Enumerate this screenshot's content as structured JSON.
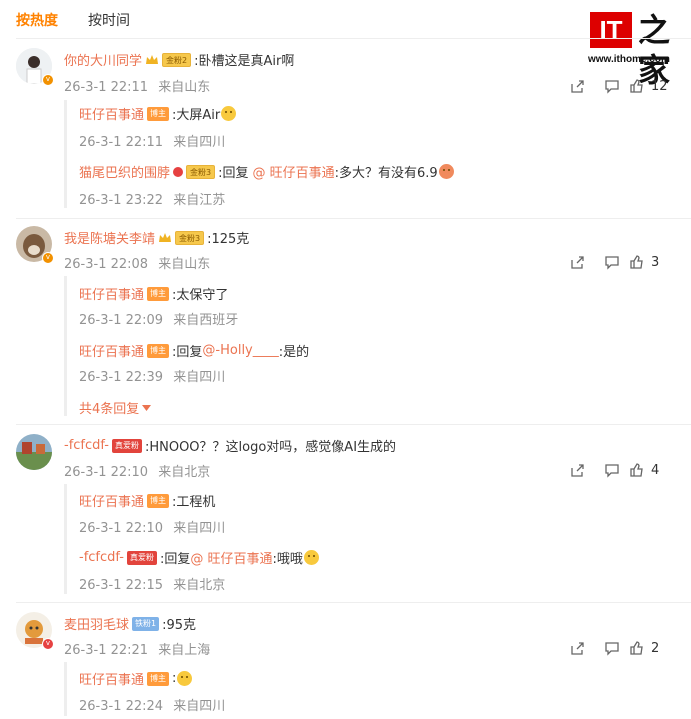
{
  "tabs": [
    {
      "label": "按热度"
    },
    {
      "label": "按时间"
    }
  ],
  "logo": {
    "mark": "IT",
    "chinese": "之家",
    "url": "www.ithome.com"
  },
  "comments": [
    {
      "user": "你的大川同学",
      "badge": "金粉2",
      "text": ":卧槽这是真Air啊",
      "time": "26-3-1 22:11",
      "location": "来自山东",
      "likes": "12",
      "replies": [
        {
          "user": "旺仔百事通",
          "badge": "博主",
          "text": ":大屏Air",
          "time": "26-3-1 22:11",
          "location": "来自四川"
        },
        {
          "user": "猫尾巴织的围脖",
          "badge": "金粉3",
          "prefix": ":回复",
          "at": "@ 旺仔百事通",
          "text": ":多大？有没有6.9",
          "time": "26-3-1 23:22",
          "location": "来自江苏"
        }
      ]
    },
    {
      "user": "我是陈塘关李靖",
      "badge": "金粉3",
      "text": ":125克",
      "time": "26-3-1 22:08",
      "location": "来自山东",
      "likes": "3",
      "replies": [
        {
          "user": "旺仔百事通",
          "badge": "博主",
          "text": ":太保守了",
          "time": "26-3-1 22:09",
          "location": "来自西班牙"
        },
        {
          "user": "旺仔百事通",
          "badge": "博主",
          "prefix": ":回复",
          "at": "@-Holly____",
          "text": ":是的",
          "time": "26-3-1 22:39",
          "location": "来自四川"
        }
      ],
      "more": "共4条回复"
    },
    {
      "user": "-fcfcdf-",
      "badge": "真爱粉",
      "text": ":HNOOO？？这logo对吗，感觉像AI生成的",
      "time": "26-3-1 22:10",
      "location": "来自北京",
      "likes": "4",
      "replies": [
        {
          "user": "旺仔百事通",
          "badge": "博主",
          "text": ":工程机",
          "time": "26-3-1 22:10",
          "location": "来自四川"
        },
        {
          "user": "-fcfcdf-",
          "badge": "真爱粉",
          "prefix": ":回复",
          "at": "@ 旺仔百事通",
          "text": ":哦哦",
          "time": "26-3-1 22:15",
          "location": "来自北京"
        }
      ]
    },
    {
      "user": "麦田羽毛球",
      "badge": "铁粉1",
      "text": ":95克",
      "time": "26-3-1 22:21",
      "location": "来自上海",
      "likes": "2",
      "replies": [
        {
          "user": "旺仔百事通",
          "badge": "博主",
          "text": ":",
          "time": "26-3-1 22:24",
          "location": "来自四川"
        }
      ]
    }
  ]
}
